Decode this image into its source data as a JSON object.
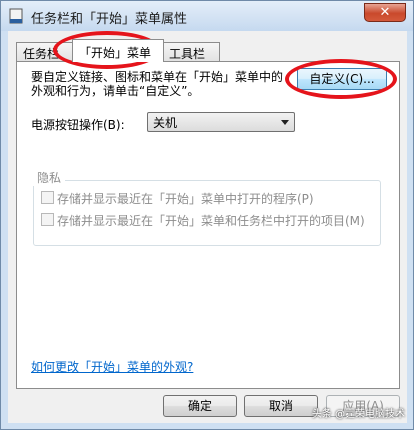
{
  "window": {
    "title": "任务栏和「开始」菜单属性",
    "close_label": "✕"
  },
  "tabs": [
    {
      "label": "任务栏",
      "active": false
    },
    {
      "label": "「开始」菜单",
      "active": true
    },
    {
      "label": "工具栏",
      "active": false
    }
  ],
  "panel": {
    "description_line1": "要自定义链接、图标和菜单在「开始」菜单中的",
    "description_line2": "外观和行为，请单击“自定义”。",
    "customize_button": "自定义(C)...",
    "power_label": "电源按钮操作(B):",
    "power_selected": "关机",
    "privacy_title": "隐私",
    "privacy_options": [
      {
        "label": "存储并显示最近在「开始」菜单中打开的程序(P)",
        "checked": false,
        "enabled": false
      },
      {
        "label": "存储并显示最近在「开始」菜单和任务栏中打开的项目(M)",
        "checked": false,
        "enabled": false
      }
    ],
    "help_link": "如何更改「开始」菜单的外观?"
  },
  "footer": {
    "ok": "确定",
    "cancel": "取消",
    "apply": "应用(A)"
  },
  "watermark": "头条 @霆荣电脑技术",
  "colors": {
    "annotation": "#e5141b",
    "link": "#0066cc",
    "close": "#c9492c"
  }
}
